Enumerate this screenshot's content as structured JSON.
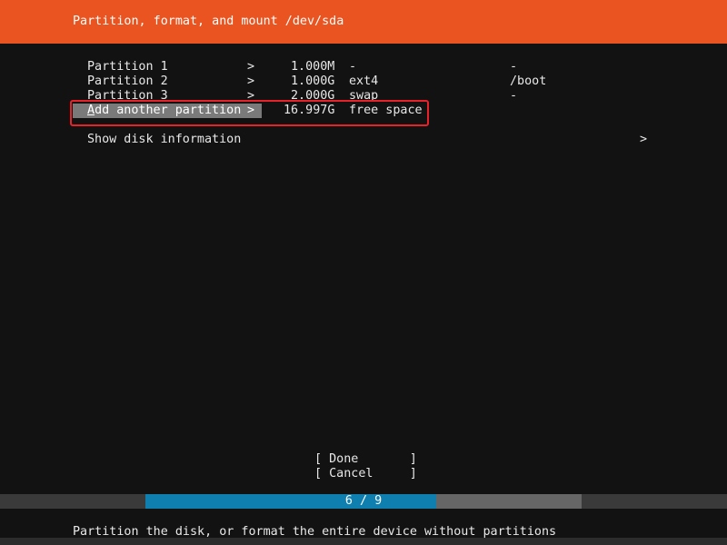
{
  "header": {
    "title": "Partition, format, and mount /dev/sda"
  },
  "partitions": [
    {
      "name": "Partition 1",
      "arrow": ">",
      "size": "1.000M",
      "fstype": "-",
      "mount": "-"
    },
    {
      "name": "Partition 2",
      "arrow": ">",
      "size": "1.000G",
      "fstype": "ext4",
      "mount": "/boot"
    },
    {
      "name": "Partition 3",
      "arrow": ">",
      "size": "2.000G",
      "fstype": "swap",
      "mount": "-"
    }
  ],
  "add_partition": {
    "label": "Add another partition",
    "arrow": ">",
    "size": "16.997G",
    "type": "free space"
  },
  "disk_info": {
    "label": "Show disk information",
    "arrow": ">"
  },
  "buttons": {
    "done": "[ Done       ]",
    "cancel": "[ Cancel     ]"
  },
  "progress": {
    "label": "6 / 9",
    "current": 6,
    "total": 9
  },
  "footer": {
    "help_text": "Partition the disk, or format the entire device without partitions"
  },
  "colors": {
    "header_bg": "#e95420",
    "progress_fill": "#0e7fae",
    "selection_bg": "#7a7a7a",
    "annotation": "#e8212b"
  }
}
